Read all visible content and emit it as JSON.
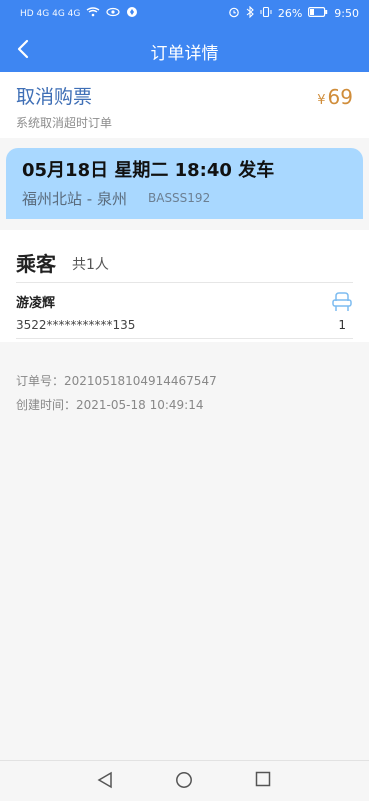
{
  "status_bar": {
    "left_indicators": "HD 4G 4G 4G",
    "battery": "26%",
    "time": "9:50"
  },
  "header": {
    "title": "订单详情"
  },
  "cancel_info": {
    "heading": "取消购票",
    "subtext": "系统取消超时订单",
    "currency": "¥",
    "amount": "69"
  },
  "trip": {
    "date_time": "05月18日 星期二 18:40 发车",
    "route": "福州北站 - 泉州",
    "code": "BASSS192"
  },
  "passengers": {
    "label": "乘客",
    "count": "共1人",
    "items": [
      {
        "name": "游凌辉",
        "id_masked": "3522***********135",
        "seat_number": "1"
      }
    ]
  },
  "order": {
    "order_no_label": "订单号：",
    "order_no": "20210518104914467547",
    "created_label": "创建时间：",
    "created_time": "2021-05-18 10:49:14"
  },
  "colors": {
    "header_bg": "#3e86f2",
    "trip_bg": "#a9d8ff",
    "price": "#d08d3a",
    "cancel_title": "#3f6fb6"
  }
}
